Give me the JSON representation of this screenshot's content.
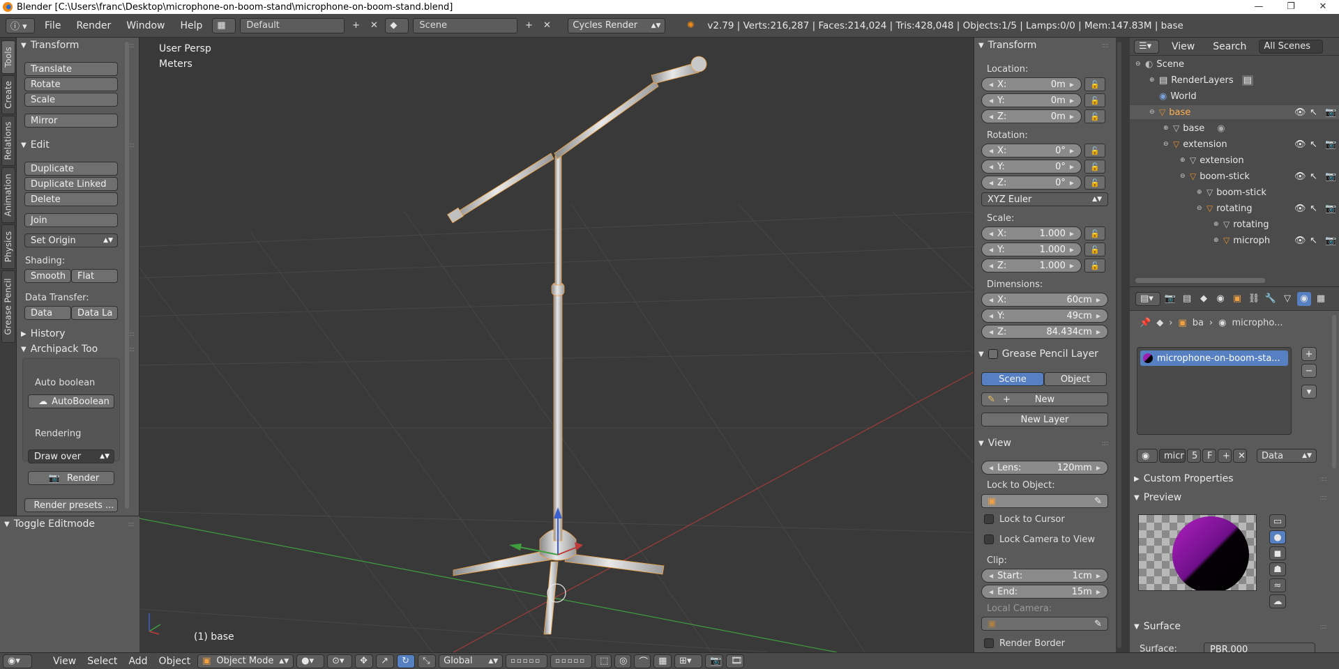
{
  "window": {
    "title": "Blender [C:\\Users\\franc\\Desktop\\microphone-on-boom-stand\\microphone-on-boom-stand.blend]",
    "controls": [
      "—",
      "❐",
      "✕"
    ]
  },
  "header": {
    "menus": [
      "File",
      "Render",
      "Window",
      "Help"
    ],
    "layout": "Default",
    "scene": "Scene",
    "engine": "Cycles Render",
    "stats": "v2.79 | Verts:216,287 | Faces:214,024 | Tris:428,048 | Objects:1/5 | Lamps:0/0 | Mem:147.83M | base"
  },
  "tool_tabs": [
    "Tools",
    "Create",
    "Relations",
    "Animation",
    "Physics",
    "Grease Pencil"
  ],
  "toolshelf": {
    "transform_title": "Transform",
    "translate": "Translate",
    "rotate": "Rotate",
    "scale": "Scale",
    "mirror": "Mirror",
    "edit_title": "Edit",
    "duplicate": "Duplicate",
    "duplicate_linked": "Duplicate Linked",
    "delete": "Delete",
    "join": "Join",
    "set_origin": "Set Origin",
    "shading_label": "Shading:",
    "smooth": "Smooth",
    "flat": "Flat",
    "data_transfer_label": "Data Transfer:",
    "data": "Data",
    "data_la": "Data La",
    "history_title": "History",
    "archipack_title": "Archipack Too",
    "auto_boolean_label": "Auto boolean",
    "autoboolean": "AutoBoolean",
    "rendering_label": "Rendering",
    "draw_over": "Draw over",
    "render": "Render",
    "render_presets": "Render presets ..."
  },
  "lower_panel": {
    "title": "Toggle Editmode"
  },
  "viewport": {
    "view_name": "User Persp",
    "units": "Meters",
    "object_label": "(1) base"
  },
  "npanel": {
    "transform_title": "Transform",
    "location_label": "Location:",
    "location": [
      {
        "axis": "X:",
        "value": "0m"
      },
      {
        "axis": "Y:",
        "value": "0m"
      },
      {
        "axis": "Z:",
        "value": "0m"
      }
    ],
    "rotation_label": "Rotation:",
    "rotation": [
      {
        "axis": "X:",
        "value": "0°"
      },
      {
        "axis": "Y:",
        "value": "0°"
      },
      {
        "axis": "Z:",
        "value": "0°"
      }
    ],
    "rotation_mode": "XYZ Euler",
    "scale_label": "Scale:",
    "scale": [
      {
        "axis": "X:",
        "value": "1.000"
      },
      {
        "axis": "Y:",
        "value": "1.000"
      },
      {
        "axis": "Z:",
        "value": "1.000"
      }
    ],
    "dimensions_label": "Dimensions:",
    "dimensions": [
      {
        "axis": "X:",
        "value": "60cm"
      },
      {
        "axis": "Y:",
        "value": "49cm"
      },
      {
        "axis": "Z:",
        "value": "84.434cm"
      }
    ],
    "grease_pencil_title": "Grease Pencil Layer",
    "scene_tab": "Scene",
    "object_tab": "Object",
    "new": "New",
    "new_layer": "New Layer",
    "view_title": "View",
    "lens_label": "Lens:",
    "lens_value": "120mm",
    "lock_to_object": "Lock to Object:",
    "lock_to_cursor": "Lock to Cursor",
    "lock_camera": "Lock Camera to View",
    "clip_label": "Clip:",
    "clip_start_label": "Start:",
    "clip_start": "1cm",
    "clip_end_label": "End:",
    "clip_end": "15m",
    "local_camera": "Local Camera:",
    "render_border": "Render Border"
  },
  "outliner": {
    "view": "View",
    "search": "Search",
    "all_scenes": "All Scenes",
    "rows": [
      {
        "label": "Scene"
      },
      {
        "label": "RenderLayers"
      },
      {
        "label": "World"
      },
      {
        "label": "base"
      },
      {
        "label": "base"
      },
      {
        "label": "extension"
      },
      {
        "label": "extension"
      },
      {
        "label": "boom-stick"
      },
      {
        "label": "boom-stick"
      },
      {
        "label": "rotating"
      },
      {
        "label": "rotating"
      },
      {
        "label": "microph"
      }
    ]
  },
  "properties": {
    "breadcrumb_obj": "ba",
    "breadcrumb_mat": "micropho...",
    "material_slot": "microphone-on-boom-sta...",
    "mat_name_short": "micr",
    "users": "5",
    "fake": "F",
    "link": "Data",
    "custom_props": "Custom Properties",
    "preview_title": "Preview",
    "surface_title": "Surface",
    "surface_label": "Surface:",
    "surface_value": "PBR.000"
  },
  "bottom": {
    "menus": [
      "View",
      "Select",
      "Add",
      "Object"
    ],
    "mode": "Object Mode",
    "orientation": "Global"
  },
  "colors": {
    "selected_blue": "#5680c2",
    "orange_outline": "#f0a040",
    "grid_line": "#4a4a4a",
    "x_axis": "#b04040",
    "y_axis": "#3f9f3f"
  }
}
